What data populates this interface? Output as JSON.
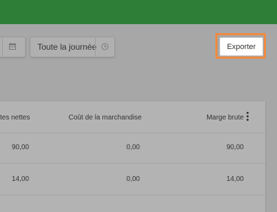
{
  "toolbar": {
    "date_icon": "calendar-icon",
    "time_filter_label": "Toute la journée",
    "time_icon": "clock-icon",
    "export_label": "Exporter",
    "highlight_color": "#f08a3e"
  },
  "header_color": "#2f7e37",
  "table": {
    "headers": [
      "tes nettes",
      "Coût de la marchandise",
      "Marge brute"
    ],
    "rows": [
      [
        "90,00",
        "0,00",
        "90,00"
      ],
      [
        "14,00",
        "0,00",
        "14,00"
      ]
    ],
    "menu_icon": "more-vertical-icon"
  }
}
